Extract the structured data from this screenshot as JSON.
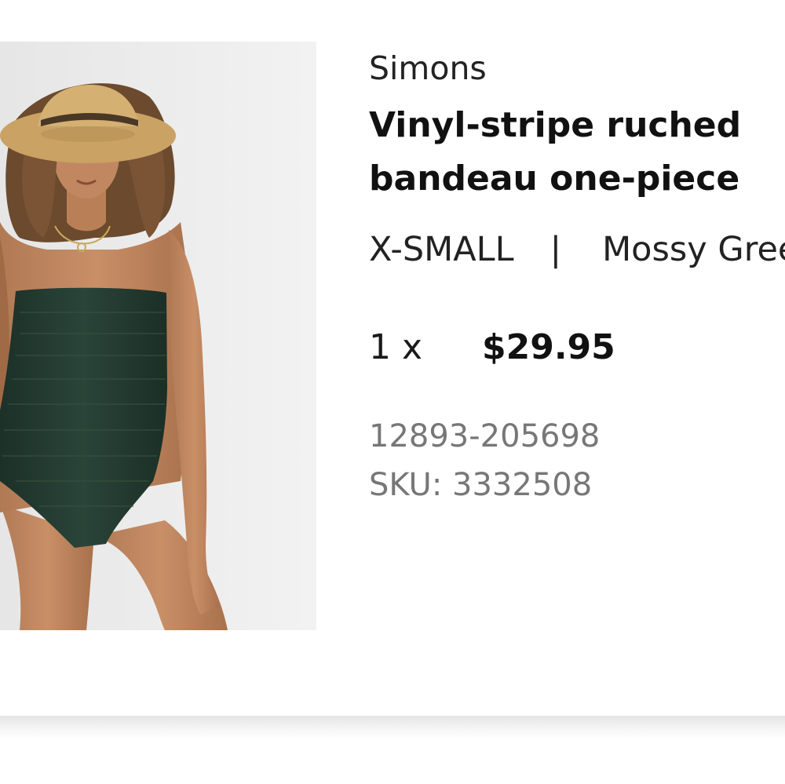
{
  "product": {
    "brand": "Simons",
    "title": "Vinyl-stripe ruched bandeau one-piece",
    "size": "X-SMALL",
    "separator": "|",
    "color": "Mossy Green",
    "quantity": "1 x",
    "price": "$29.95",
    "item_number": "12893-205698",
    "sku": "SKU: 3332508"
  },
  "colors": {
    "swimsuit": "#233a30",
    "image_background": "#ececec",
    "price_text": "#111111",
    "code_text": "#777777"
  }
}
